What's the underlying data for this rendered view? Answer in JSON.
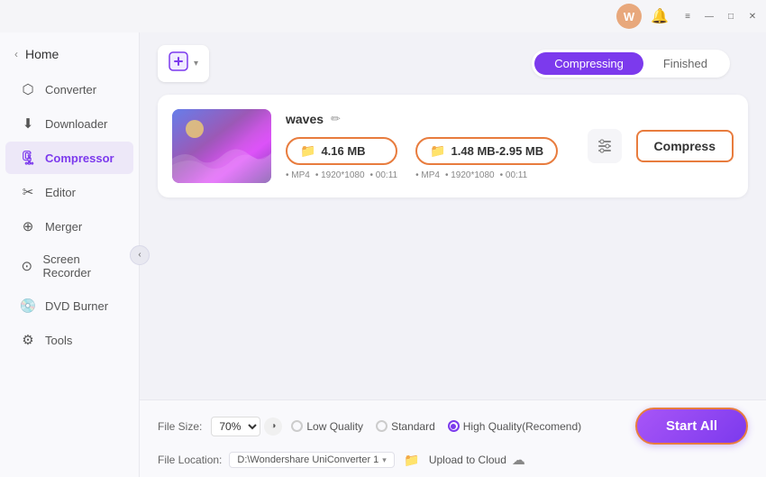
{
  "titlebar": {
    "avatar_label": "W",
    "bell_icon": "🔔",
    "menu_icon": "≡",
    "minimize_icon": "—",
    "maximize_icon": "□",
    "close_icon": "✕"
  },
  "sidebar": {
    "home_label": "Home",
    "collapse_icon": "‹",
    "items": [
      {
        "id": "converter",
        "label": "Converter",
        "icon": "⬡"
      },
      {
        "id": "downloader",
        "label": "Downloader",
        "icon": "⬇"
      },
      {
        "id": "compressor",
        "label": "Compressor",
        "icon": "🗜",
        "active": true
      },
      {
        "id": "editor",
        "label": "Editor",
        "icon": "✂"
      },
      {
        "id": "merger",
        "label": "Merger",
        "icon": "⊕"
      },
      {
        "id": "screen-recorder",
        "label": "Screen Recorder",
        "icon": "⊙"
      },
      {
        "id": "dvd-burner",
        "label": "DVD Burner",
        "icon": "💿"
      },
      {
        "id": "tools",
        "label": "Tools",
        "icon": "⚙"
      }
    ]
  },
  "tabs": [
    {
      "id": "compressing",
      "label": "Compressing",
      "active": true
    },
    {
      "id": "finished",
      "label": "Finished",
      "active": false
    }
  ],
  "add_button": {
    "label": "",
    "chevron": "▾"
  },
  "file_card": {
    "filename": "waves",
    "edit_icon": "✏",
    "original_size": "4.16 MB",
    "original_meta": [
      "MP4",
      "1920*1080",
      "00:11"
    ],
    "compressed_size": "1.48 MB-2.95 MB",
    "compressed_meta": [
      "MP4",
      "1920*1080",
      "00:11"
    ],
    "settings_icon": "⚙",
    "compress_label": "Compress"
  },
  "footer": {
    "file_size_label": "File Size:",
    "size_percent": "70%",
    "quality_icon": "◑",
    "radio_options": [
      {
        "id": "low",
        "label": "Low Quality",
        "checked": false
      },
      {
        "id": "standard",
        "label": "Standard",
        "checked": false
      },
      {
        "id": "high",
        "label": "High Quality(Recomend)",
        "checked": true
      }
    ],
    "start_all_label": "Start All",
    "file_location_label": "File Location:",
    "location_path": "D:\\Wondershare UniConverter 1",
    "location_chevron": "▾",
    "folder_icon": "📁",
    "upload_label": "Upload to Cloud",
    "cloud_icon": "☁"
  }
}
